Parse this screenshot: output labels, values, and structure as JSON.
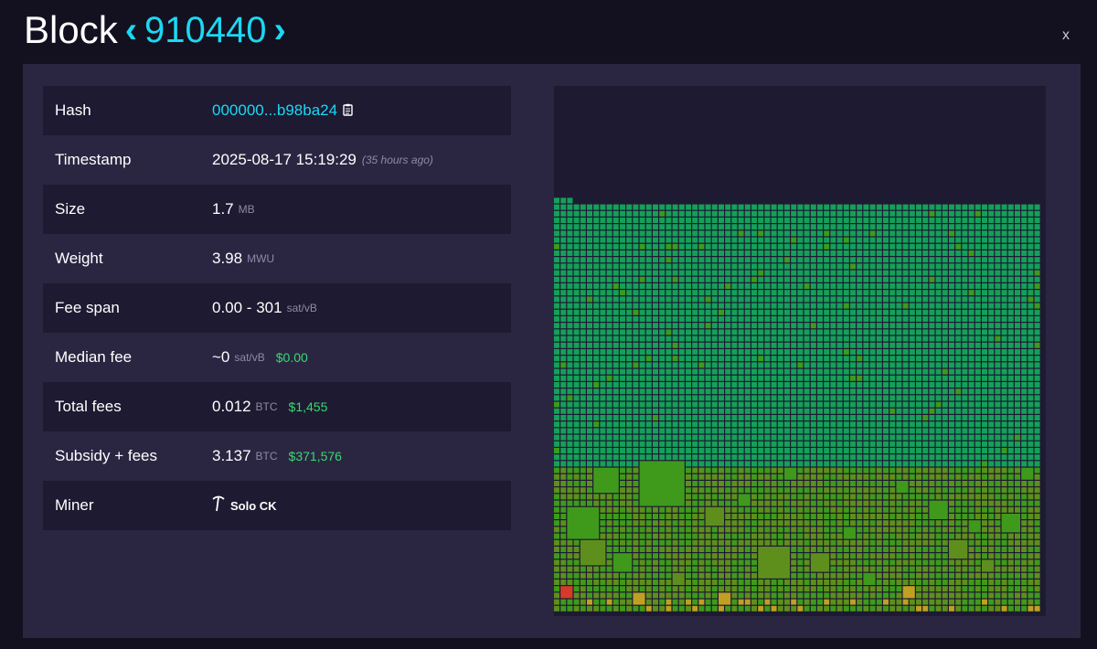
{
  "header": {
    "title": "Block",
    "height": "910440",
    "prev_symbol": "‹",
    "next_symbol": "›",
    "close_label": "x"
  },
  "details": {
    "hash": {
      "label": "Hash",
      "value": "000000...b98ba24"
    },
    "timestamp": {
      "label": "Timestamp",
      "value": "2025-08-17 15:19:29",
      "relative": "(35 hours ago)"
    },
    "size": {
      "label": "Size",
      "value": "1.7",
      "unit": "MB"
    },
    "weight": {
      "label": "Weight",
      "value": "3.98",
      "unit": "MWU"
    },
    "fee_span": {
      "label": "Fee span",
      "value": "0.00 - 301",
      "unit": "sat/vB"
    },
    "median_fee": {
      "label": "Median fee",
      "value": "~0",
      "unit": "sat/vB",
      "fiat": "$0.00"
    },
    "total_fees": {
      "label": "Total fees",
      "value": "0.012",
      "unit": "BTC",
      "fiat": "$1,455"
    },
    "subsidy_fees": {
      "label": "Subsidy + fees",
      "value": "3.137",
      "unit": "BTC",
      "fiat": "$371,576"
    },
    "miner": {
      "label": "Miner",
      "value": "Solo CK"
    }
  },
  "block_visualization": {
    "fill_fraction": 0.77,
    "colors": {
      "low_fee": "#14a05a",
      "mid_fee": "#3f9a1c",
      "mid_high_fee": "#5e8f1d",
      "high_fee": "#c0a020",
      "top_fee": "#d63a2a",
      "empty": "#1d1a31"
    }
  }
}
